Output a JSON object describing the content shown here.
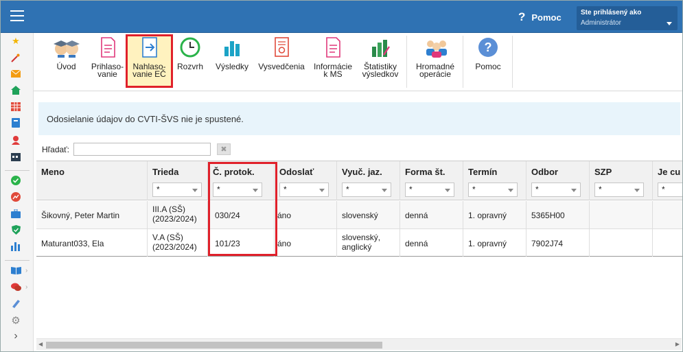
{
  "header": {
    "help_label": "Pomoc",
    "user_line1": "Ste prihlásený ako",
    "user_line2": "Administrátor"
  },
  "toolbar": {
    "items": [
      {
        "l1": "Úvod",
        "l2": ""
      },
      {
        "l1": "Prihlaso-",
        "l2": "vanie"
      },
      {
        "l1": "Nahlaso-",
        "l2": "vanie EČ"
      },
      {
        "l1": "Rozvrh",
        "l2": ""
      },
      {
        "l1": "Výsledky",
        "l2": ""
      },
      {
        "l1": "Vysvedčenia",
        "l2": ""
      },
      {
        "l1": "Informácie",
        "l2": "k MS"
      },
      {
        "l1": "Štatistiky",
        "l2": "výsledkov"
      },
      {
        "l1": "Hromadné",
        "l2": "operácie"
      },
      {
        "l1": "Pomoc",
        "l2": ""
      }
    ]
  },
  "info_message": "Odosielanie údajov do CVTI-ŠVS nie je spustené.",
  "search": {
    "label": "Hľadať:",
    "value": ""
  },
  "table": {
    "columns": [
      "Meno",
      "Trieda",
      "Č. protok.",
      "Odoslať",
      "Vyuč. jaz.",
      "Forma št.",
      "Termín",
      "Odbor",
      "SZP",
      "Je cu"
    ],
    "filter_value": "*",
    "rows": [
      {
        "meno": "Šikovný, Peter Martin",
        "trieda1": "III.A (SŠ)",
        "trieda2": "(2023/2024)",
        "protok": "030/24",
        "odoslat": "áno",
        "jaz1": "slovenský",
        "jaz2": "",
        "forma": "denná",
        "termin": "1. opravný",
        "odbor": "5365H00"
      },
      {
        "meno": "Maturant033, Ela",
        "trieda1": "V.A (SŠ)",
        "trieda2": "(2023/2024)",
        "protok": "101/23",
        "odoslat": "áno",
        "jaz1": "slovenský,",
        "jaz2": "anglický",
        "forma": "denná",
        "termin": "1. opravný",
        "odbor": "7902J74"
      }
    ]
  },
  "colors": {
    "header": "#2f72b3",
    "highlight": "#e0202a",
    "info_bg": "#e8f4fb"
  }
}
